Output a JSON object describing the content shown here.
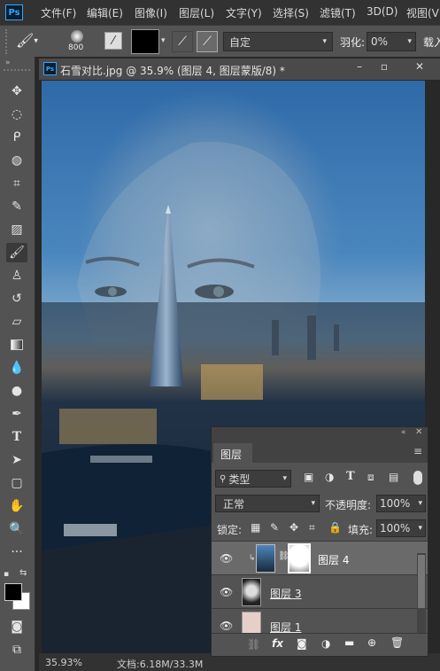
{
  "app": {
    "logo": "Ps"
  },
  "menu": [
    "文件(F)",
    "编辑(E)",
    "图像(I)",
    "图层(L)",
    "文字(Y)",
    "选择(S)",
    "滤镜(T)",
    "3D(D)",
    "视图(V)"
  ],
  "options": {
    "brush_size": "800",
    "mode_value": "自定",
    "feather_label": "羽化:",
    "feather_value": "0%",
    "overflow_label": "载入"
  },
  "document": {
    "title": "石雪对比.jpg @ 35.9% (图层 4, 图层蒙版/8) *",
    "zoom": "35.93%",
    "doc_info": "文档:6.18M/33.3M"
  },
  "layers_panel": {
    "title": "图层",
    "filter_kind": "类型",
    "blend_mode": "正常",
    "opacity_label": "不透明度:",
    "opacity_value": "100%",
    "lock_label": "锁定:",
    "fill_label": "填充:",
    "fill_value": "100%",
    "layers": [
      {
        "name": "图层 4",
        "selected": true
      },
      {
        "name": "图层 3",
        "selected": false
      },
      {
        "name": "图层 1",
        "selected": false
      }
    ]
  },
  "colors": {
    "accent": "#31a8ff",
    "panel_bg": "#535353",
    "dark_bg": "#282828"
  }
}
